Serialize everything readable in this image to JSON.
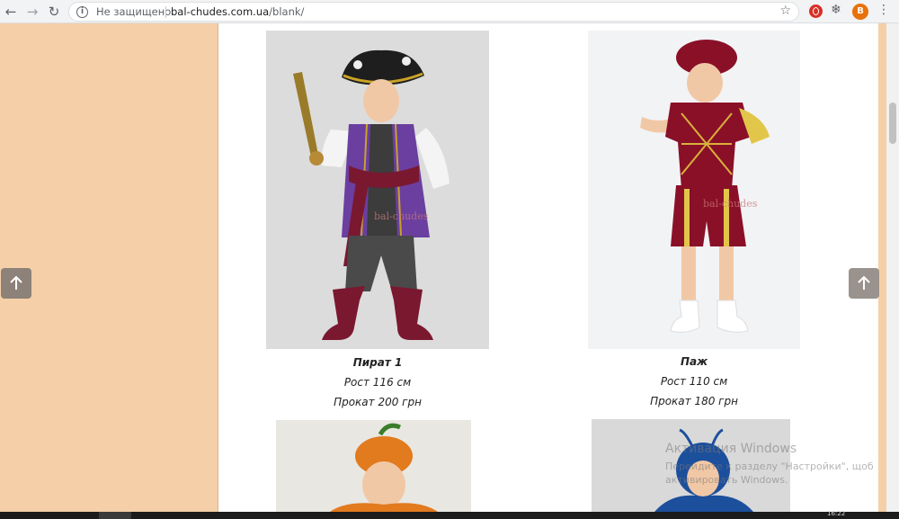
{
  "browser": {
    "secure_text": "Не защищено",
    "url_host": "bal-chudes.com.ua",
    "url_path": "/blank/",
    "avatar_letter": "B"
  },
  "products": [
    {
      "name": "Пират 1",
      "height": "Рост 116 см",
      "price": "Прокат 200 грн",
      "watermark": "bal-chudes"
    },
    {
      "name": "Паж",
      "height": "Рост 110 см",
      "price": "Прокат 180 грн",
      "watermark": "bal-chudes"
    }
  ],
  "windows_activation": {
    "title": "Активация Windows",
    "line1": "Перейдите к разделу \"Настройки\", щоб",
    "line2": "активировать Windows."
  },
  "taskbar": {
    "clock": "16:22"
  },
  "colors": {
    "side_band": "#f5cfa7",
    "scroll_button": "#8c8279",
    "avatar": "#e8710a"
  }
}
